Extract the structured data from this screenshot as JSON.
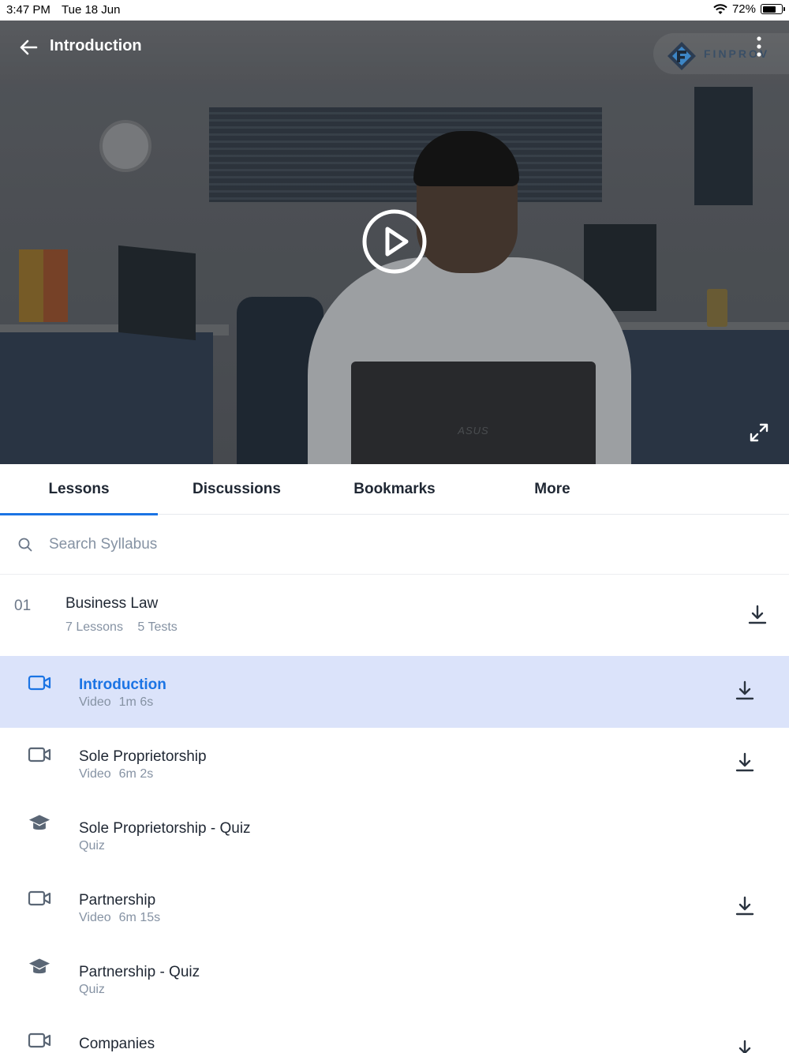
{
  "status_bar": {
    "time": "3:47 PM",
    "date": "Tue 18 Jun",
    "battery": "72%",
    "battery_level": 0.72
  },
  "video": {
    "title": "Introduction",
    "brand": "FINPROV",
    "laptop_brand": "ASUS",
    "icons": [
      "back-arrow-icon",
      "more-vertical-icon",
      "play-icon",
      "fullscreen-icon"
    ]
  },
  "tabs": [
    {
      "label": "Lessons",
      "active": true
    },
    {
      "label": "Discussions",
      "active": false
    },
    {
      "label": "Bookmarks",
      "active": false
    },
    {
      "label": "More",
      "active": false
    }
  ],
  "search": {
    "placeholder": "Search Syllabus",
    "value": ""
  },
  "module": {
    "number": "01",
    "title": "Business Law",
    "lessons_count": "7 Lessons",
    "tests_count": "5 Tests"
  },
  "lessons": [
    {
      "title": "Introduction",
      "type": "Video",
      "duration": "1m 6s",
      "icon": "video-icon",
      "downloadable": true,
      "active": true
    },
    {
      "title": "Sole Proprietorship",
      "type": "Video",
      "duration": "6m 2s",
      "icon": "video-icon",
      "downloadable": true,
      "active": false
    },
    {
      "title": "Sole Proprietorship - Quiz",
      "type": "Quiz",
      "duration": "",
      "icon": "graduation-cap-icon",
      "downloadable": false,
      "active": false
    },
    {
      "title": "Partnership",
      "type": "Video",
      "duration": "6m 15s",
      "icon": "video-icon",
      "downloadable": true,
      "active": false
    },
    {
      "title": "Partnership - Quiz",
      "type": "Quiz",
      "duration": "",
      "icon": "graduation-cap-icon",
      "downloadable": false,
      "active": false
    },
    {
      "title": "Companies",
      "type": "",
      "duration": "",
      "icon": "video-icon",
      "downloadable": true,
      "active": false
    }
  ],
  "colors": {
    "accent": "#1b74e4",
    "active_row": "#dbe3fa",
    "muted_text": "#8592a3",
    "text": "#1f2733"
  }
}
